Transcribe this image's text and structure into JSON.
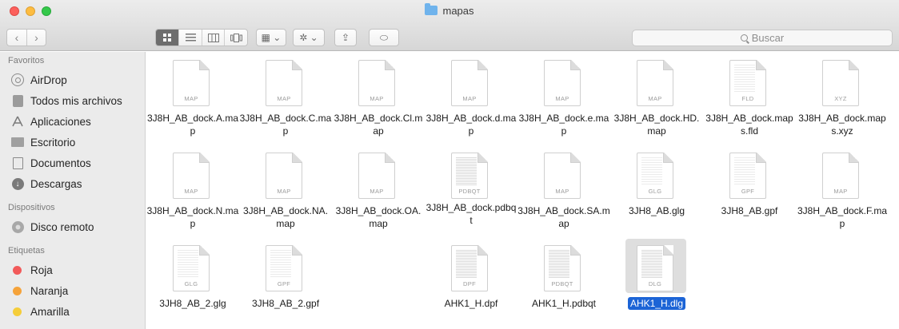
{
  "window": {
    "title": "mapas"
  },
  "toolbar": {
    "nav_back": "‹",
    "nav_forward": "›",
    "views": [
      "icons",
      "list",
      "columns",
      "coverflow"
    ],
    "group_label": "▦ ⌄",
    "action_label": "✲ ⌄",
    "share_label": "⇪",
    "tag_label": "⬭"
  },
  "search": {
    "placeholder": "Buscar"
  },
  "sidebar": {
    "favorites_header": "Favoritos",
    "favorites": [
      {
        "label": "AirDrop",
        "icon": "airdrop-icon"
      },
      {
        "label": "Todos mis archivos",
        "icon": "all-files-icon"
      },
      {
        "label": "Aplicaciones",
        "icon": "applications-icon"
      },
      {
        "label": "Escritorio",
        "icon": "desktop-icon"
      },
      {
        "label": "Documentos",
        "icon": "documents-icon"
      },
      {
        "label": "Descargas",
        "icon": "downloads-icon"
      }
    ],
    "devices_header": "Dispositivos",
    "devices": [
      {
        "label": "Disco remoto",
        "icon": "disk-icon"
      }
    ],
    "tags_header": "Etiquetas",
    "tags": [
      {
        "label": "Roja",
        "color": "#f25a5a"
      },
      {
        "label": "Naranja",
        "color": "#f5a33a"
      },
      {
        "label": "Amarilla",
        "color": "#f5cd3a"
      }
    ]
  },
  "files": [
    {
      "name": "3J8H_AB_dock.A.map",
      "ext": "MAP"
    },
    {
      "name": "3J8H_AB_dock.C.map",
      "ext": "MAP"
    },
    {
      "name": "3J8H_AB_dock.Cl.map",
      "ext": "MAP"
    },
    {
      "name": "3J8H_AB_dock.d.map",
      "ext": "MAP"
    },
    {
      "name": "3J8H_AB_dock.e.map",
      "ext": "MAP"
    },
    {
      "name": "3J8H_AB_dock.HD.map",
      "ext": "MAP"
    },
    {
      "name": "3J8H_AB_dock.maps.fld",
      "ext": "FLD"
    },
    {
      "name": "3J8H_AB_dock.maps.xyz",
      "ext": "XYZ"
    },
    {
      "name": "3J8H_AB_dock.N.map",
      "ext": "MAP"
    },
    {
      "name": "3J8H_AB_dock.NA.map",
      "ext": "MAP"
    },
    {
      "name": "3J8H_AB_dock.OA.map",
      "ext": "MAP"
    },
    {
      "name": "3J8H_AB_dock.pdbqt",
      "ext": "PDBQT"
    },
    {
      "name": "3J8H_AB_dock.SA.map",
      "ext": "MAP"
    },
    {
      "name": "3JH8_AB.glg",
      "ext": "GLG"
    },
    {
      "name": "3JH8_AB.gpf",
      "ext": "GPF"
    },
    {
      "name": "3J8H_AB_dock.F.map",
      "ext": "MAP"
    },
    {
      "name": "3JH8_AB_2.glg",
      "ext": "GLG"
    },
    {
      "name": "3JH8_AB_2.gpf",
      "ext": "GPF"
    },
    {
      "name": "AHK1_H.dpf",
      "ext": "DPF"
    },
    {
      "name": "AHK1_H.pdbqt",
      "ext": "PDBQT"
    },
    {
      "name": "AHK1_H.dlg",
      "ext": "DLG"
    }
  ]
}
